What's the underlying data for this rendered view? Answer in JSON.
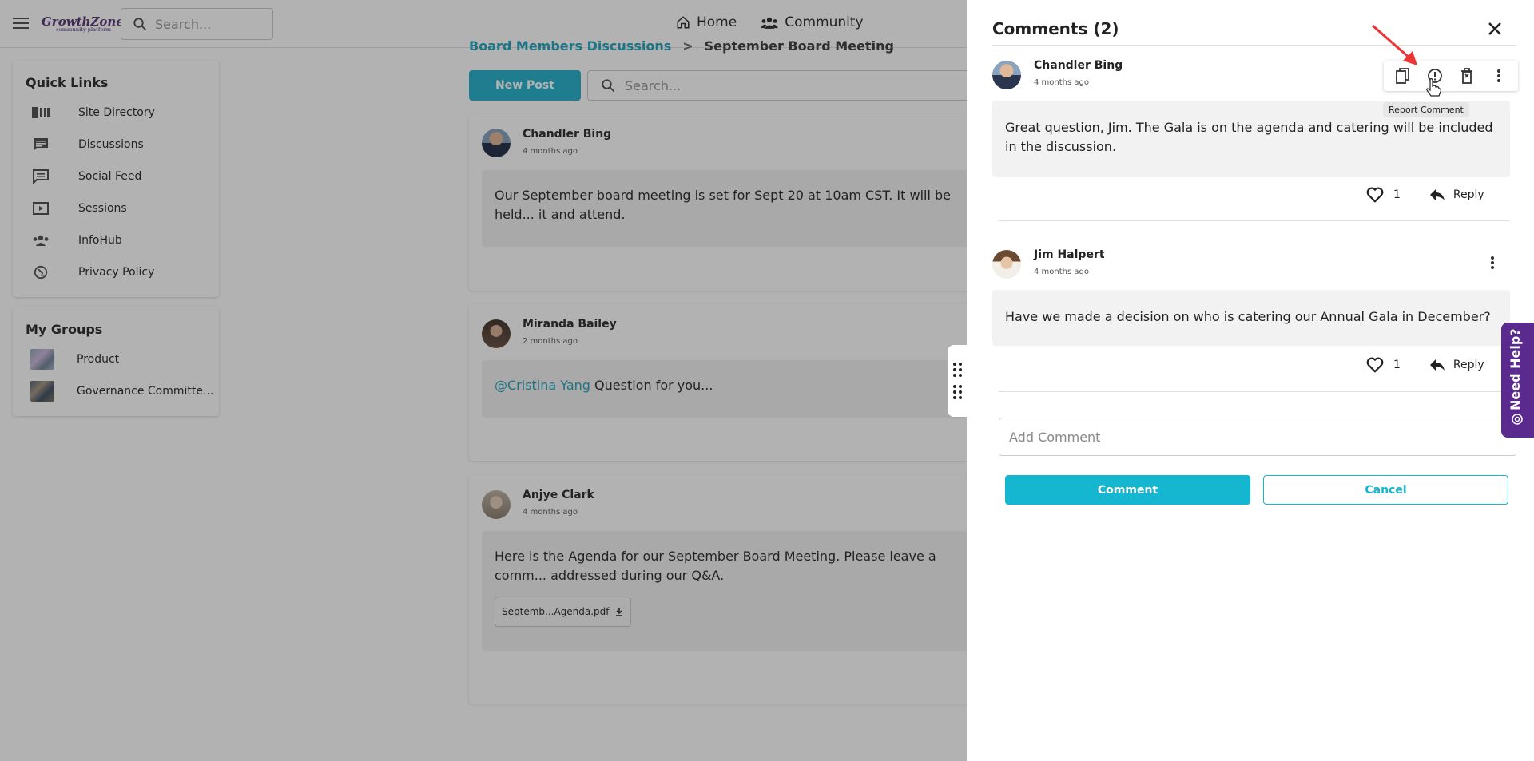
{
  "topbar": {
    "logo": "GrowthZone",
    "logo_sub": "community platform",
    "search_placeholder": "Search...",
    "nav": [
      {
        "label": "Home"
      },
      {
        "label": "Community"
      }
    ]
  },
  "sidebar": {
    "quick_links_title": "Quick Links",
    "quick_links": [
      {
        "label": "Site Directory"
      },
      {
        "label": "Discussions"
      },
      {
        "label": "Social Feed"
      },
      {
        "label": "Sessions"
      },
      {
        "label": "InfoHub"
      },
      {
        "label": "Privacy Policy"
      }
    ],
    "groups_title": "My Groups",
    "groups": [
      {
        "label": "Product"
      },
      {
        "label": "Governance Committe..."
      }
    ]
  },
  "main": {
    "breadcrumb": {
      "parent": "Board Members Discussions",
      "separator": ">",
      "current": "September Board Meeting"
    },
    "new_post_label": "New Post",
    "search_placeholder": "Search...",
    "posts": [
      {
        "author": "Chandler Bing",
        "time": "4 months ago",
        "body": "Our September board meeting is set for Sept 20 at 10am CST. It will be held... it and attend."
      },
      {
        "author": "Miranda Bailey",
        "time": "2 months ago",
        "mention": "@Cristina Yang",
        "body": " Question for you..."
      },
      {
        "author": "Anjye Clark",
        "time": "4 months ago",
        "body": "Here is the Agenda for our September Board Meeting. Please leave a comm... addressed during our Q&A.",
        "attachment": "Septemb...Agenda.pdf"
      }
    ]
  },
  "comments_panel": {
    "title": "Comments (2)",
    "tooltip": "Report Comment",
    "comments": [
      {
        "author": "Chandler Bing",
        "time": "4 months ago",
        "body": "Great question, Jim. The Gala is on the agenda and catering will be included in the discussion.",
        "likes": "1",
        "reply_label": "Reply"
      },
      {
        "author": "Jim Halpert",
        "time": "4 months ago",
        "body": "Have we made a decision on who is catering our Annual Gala in December?",
        "likes": "1",
        "reply_label": "Reply"
      }
    ],
    "add_comment_placeholder": "Add Comment",
    "comment_button": "Comment",
    "cancel_button": "Cancel"
  },
  "help_tab": {
    "label": "Need Help?"
  }
}
